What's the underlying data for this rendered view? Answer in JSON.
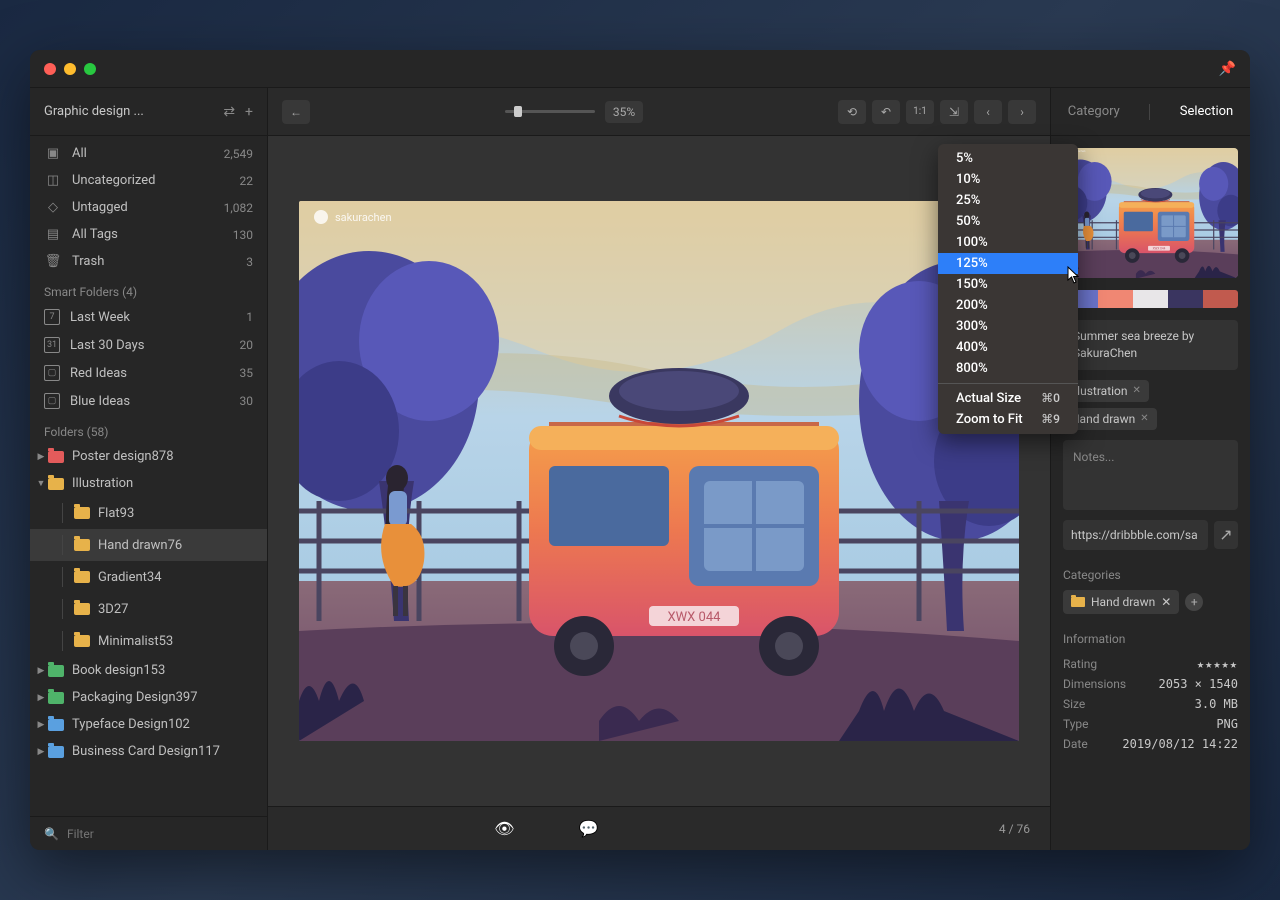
{
  "window": {
    "title": "Graphic design ..."
  },
  "library": {
    "items": [
      {
        "icon": "all",
        "label": "All",
        "count": "2,549"
      },
      {
        "icon": "uncat",
        "label": "Uncategorized",
        "count": "22"
      },
      {
        "icon": "untag",
        "label": "Untagged",
        "count": "1,082"
      },
      {
        "icon": "tags",
        "label": "All Tags",
        "count": "130"
      },
      {
        "icon": "trash",
        "label": "Trash",
        "count": "3"
      }
    ]
  },
  "smart_folders": {
    "header": "Smart Folders (4)",
    "items": [
      {
        "label": "Last Week",
        "count": "1"
      },
      {
        "label": "Last 30 Days",
        "count": "20"
      },
      {
        "label": "Red Ideas",
        "count": "35"
      },
      {
        "label": "Blue Ideas",
        "count": "30"
      }
    ]
  },
  "folders": {
    "header": "Folders (58)",
    "items": [
      {
        "label": "Poster design",
        "count": "878",
        "color": "#e35b5b",
        "expandable": true
      },
      {
        "label": "Illustration",
        "count": "",
        "color": "#e7b24a",
        "expandable": true,
        "expanded": true,
        "children": [
          {
            "label": "Flat",
            "count": "93",
            "color": "#e7b24a"
          },
          {
            "label": "Hand drawn",
            "count": "76",
            "color": "#e7b24a",
            "selected": true
          },
          {
            "label": "Gradient",
            "count": "34",
            "color": "#e7b24a"
          },
          {
            "label": "3D",
            "count": "27",
            "color": "#e7b24a"
          },
          {
            "label": "Minimalist",
            "count": "53",
            "color": "#e7b24a"
          }
        ]
      },
      {
        "label": "Book design",
        "count": "153",
        "color": "#4fb36a",
        "expandable": true
      },
      {
        "label": "Packaging Design",
        "count": "397",
        "color": "#4fb36a",
        "expandable": true
      },
      {
        "label": "Typeface Design",
        "count": "102",
        "color": "#5aa0e0",
        "expandable": true
      },
      {
        "label": "Business Card Design",
        "count": "117",
        "color": "#5aa0e0",
        "expandable": true
      }
    ]
  },
  "filter_placeholder": "Filter",
  "toolbar": {
    "zoom": "35%"
  },
  "zoom_menu": {
    "levels": [
      "5%",
      "10%",
      "25%",
      "50%",
      "100%",
      "125%",
      "150%",
      "200%",
      "300%",
      "400%",
      "800%"
    ],
    "highlighted": "125%",
    "actual": {
      "label": "Actual Size",
      "shortcut": "⌘0"
    },
    "fit": {
      "label": "Zoom to Fit",
      "shortcut": "⌘9"
    }
  },
  "footer": {
    "index": "4",
    "total": "76"
  },
  "inspector": {
    "tabs": {
      "category": "Category",
      "selection": "Selection"
    },
    "title": "Summer sea breeze by SakuraChen",
    "tags": [
      "Illustration",
      "Hand drawn"
    ],
    "notes_placeholder": "Notes...",
    "url": "https://dribbble.com/sa",
    "categories_header": "Categories",
    "category_tag": "Hand drawn",
    "info_header": "Information",
    "info": {
      "rating_label": "Rating",
      "dimensions_label": "Dimensions",
      "dimensions": "2053 × 1540",
      "size_label": "Size",
      "size": "3.0 MB",
      "type_label": "Type",
      "type": "PNG",
      "date_label": "Date",
      "date": "2019/08/12 14:22"
    },
    "palette": [
      "#6a73c9",
      "#f08773",
      "#e8e6e8",
      "#3a3560",
      "#c15a4e"
    ]
  },
  "artwork_credit": "sakurachen"
}
